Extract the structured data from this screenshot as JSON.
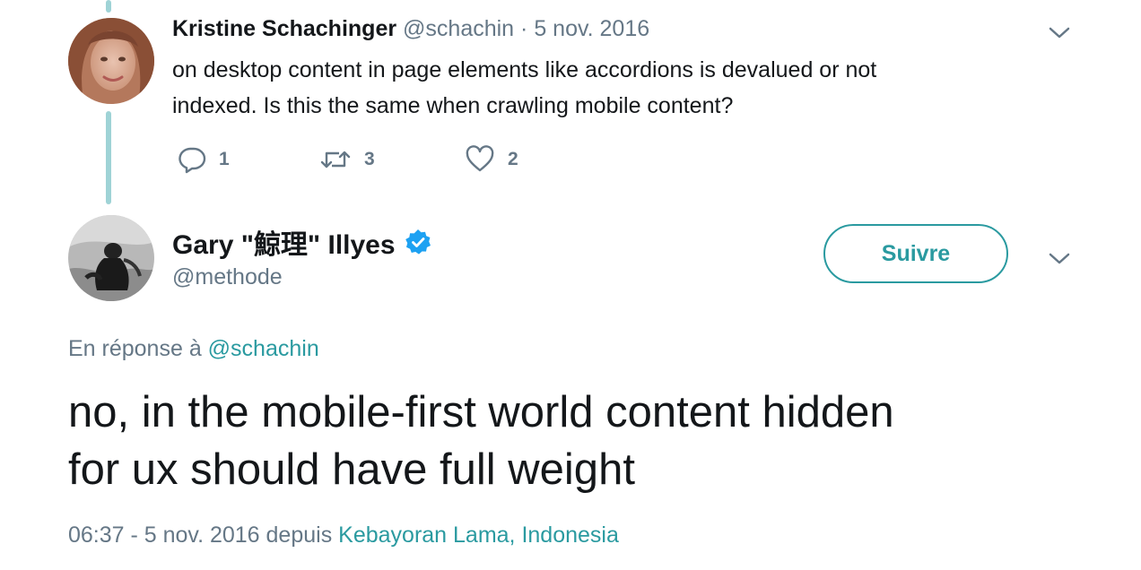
{
  "parent_tweet": {
    "author_name": "Kristine Schachinger",
    "author_handle": "@schachin",
    "separator": "·",
    "date": "5 nov. 2016",
    "text_line1": "on desktop content in page elements like accordions is devalued or not",
    "text_line2": "indexed. Is this the same when crawling mobile content?",
    "actions": {
      "reply_icon": "reply-bubble-icon",
      "reply_count": "1",
      "retweet_icon": "retweet-icon",
      "retweet_count": "3",
      "like_icon": "heart-icon",
      "like_count": "2"
    }
  },
  "main_tweet": {
    "author_name": "Gary \"鯨理\" Illyes",
    "verified": true,
    "author_handle": "@methode",
    "follow_label": "Suivre",
    "reply_prefix": "En réponse à",
    "reply_to": "@schachin",
    "text_line1": "no, in the mobile-first world content hidden",
    "text_line2": "for ux should have full weight",
    "timestamp": "06:37 - 5 nov. 2016 depuis",
    "location": "Kebayoran Lama, Indonesia"
  },
  "colors": {
    "accent": "#2a9aa0",
    "thread_line": "#9fd3d6",
    "verified": "#1da1f2",
    "muted": "#657786"
  }
}
